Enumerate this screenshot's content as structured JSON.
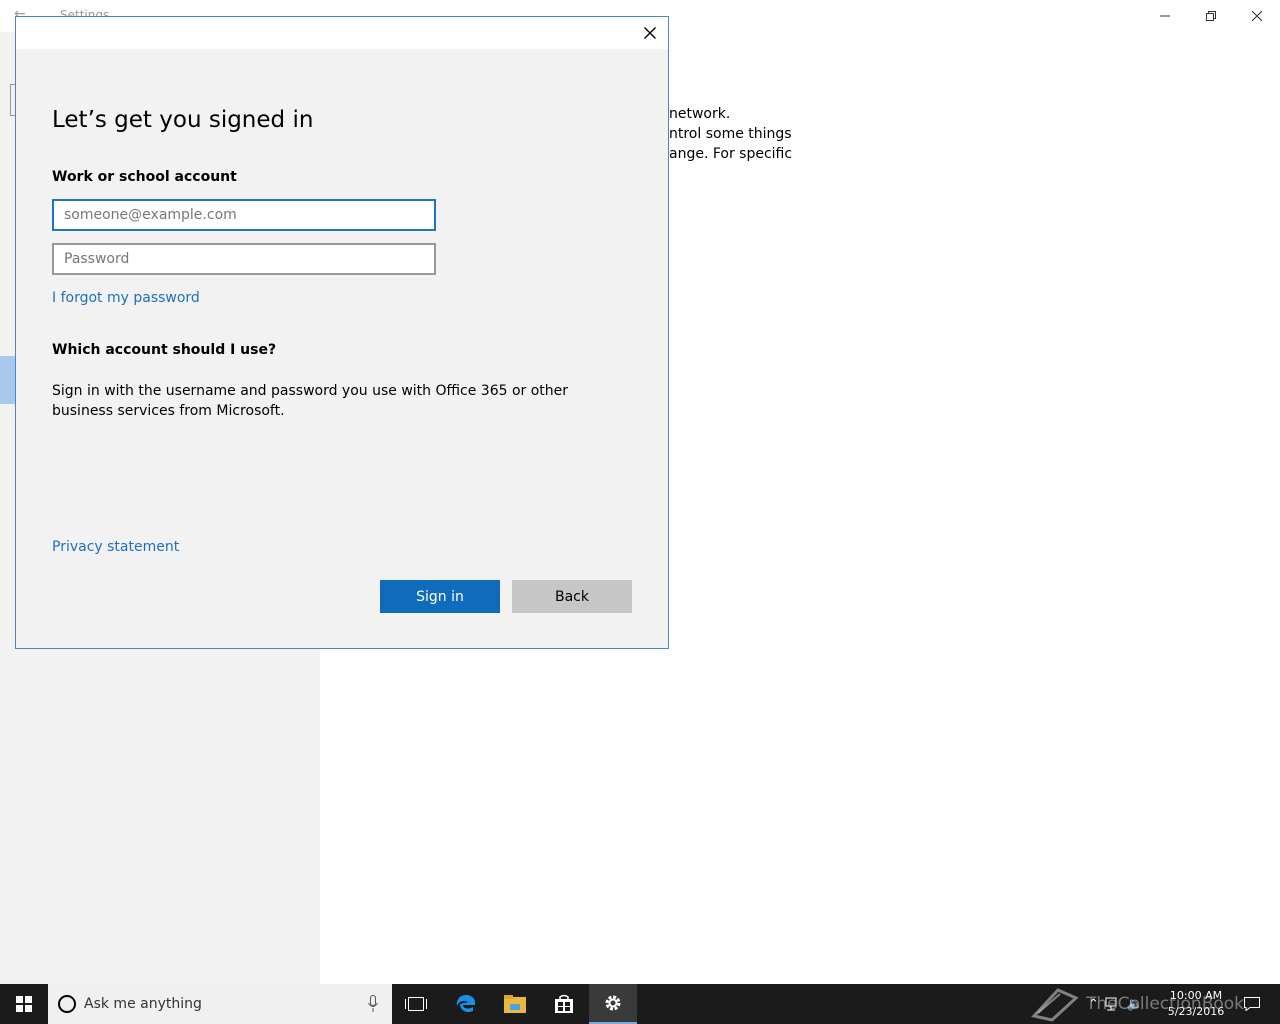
{
  "background_window": {
    "title": "Settings",
    "text_lines": [
      "network.",
      "ntrol some things",
      "ange. For specific"
    ]
  },
  "dialog": {
    "heading": "Let’s get you signed in",
    "account_label": "Work or school account",
    "email_placeholder": "someone@example.com",
    "password_placeholder": "Password",
    "forgot_link": "I forgot my password",
    "which_account_heading": "Which account should I use?",
    "description": "Sign in with the username and password you use with Office 365 or other business services from Microsoft.",
    "privacy_link": "Privacy statement",
    "signin_label": "Sign in",
    "back_label": "Back"
  },
  "taskbar": {
    "search_placeholder": "Ask me anything",
    "time": "10:00 AM",
    "date": "5/23/2016",
    "pinned_icons": [
      "task-view-icon",
      "edge-icon",
      "file-explorer-icon",
      "store-icon",
      "settings-gear-icon"
    ]
  },
  "watermark": "TheCollectionBook",
  "colors": {
    "accent": "#0f6cbd",
    "link": "#1e6fbe",
    "dialog_bg": "#f2f2f2",
    "taskbar_bg": "#1b1b1b"
  }
}
